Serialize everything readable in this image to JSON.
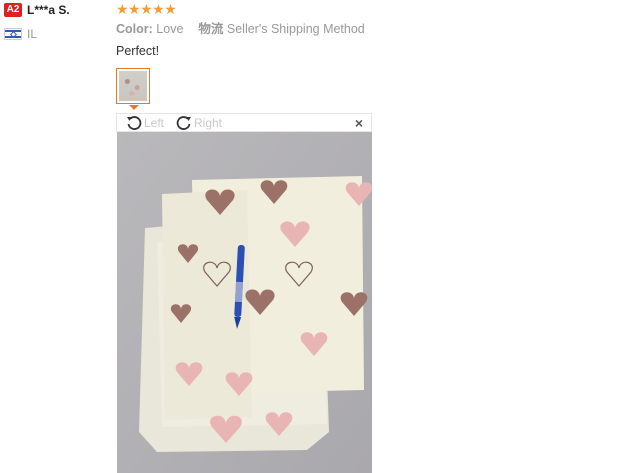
{
  "review": {
    "badge": "A2",
    "user_name": "L***a S.",
    "country": "IL",
    "rating_stars": "★★★★★",
    "rating": 5,
    "color_label": "Color:",
    "color_value": "Love",
    "shipping_label": "物流",
    "shipping_value": "Seller's Shipping Method",
    "text": "Perfect!"
  },
  "viewer": {
    "rotate_left_label": "Left",
    "rotate_right_label": "Right",
    "close_label": "×"
  },
  "colors": {
    "badge": "#d9231f",
    "stars": "#f29d38",
    "thumb_border": "#e07a2e"
  }
}
